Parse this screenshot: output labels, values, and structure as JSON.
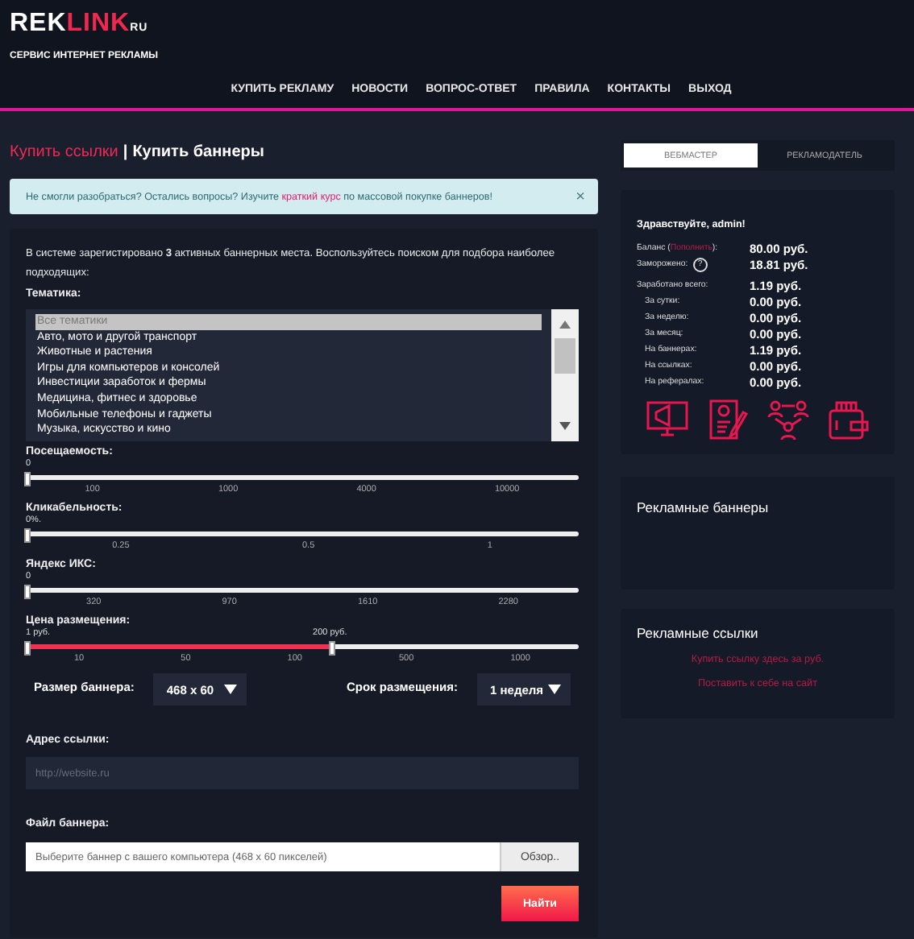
{
  "header": {
    "logo_main": "REK",
    "logo_accent": "LINK",
    "logo_suffix": "RU",
    "tagline": "СЕРВИС ИНТЕРНЕТ РЕКЛАМЫ",
    "nav": [
      {
        "label": "КУПИТЬ РЕКЛАМУ"
      },
      {
        "label": "НОВОСТИ"
      },
      {
        "label": "ВОПРОС-ОТВЕТ"
      },
      {
        "label": "ПРАВИЛА"
      },
      {
        "label": "КОНТАКТЫ"
      },
      {
        "label": "ВЫХОД"
      }
    ]
  },
  "page_title": {
    "link": "Купить ссылки",
    "separator": "|",
    "current": "Купить баннеры"
  },
  "alert": {
    "text_before": "Не смогли разобраться? Остались вопросы? Изучите ",
    "link": "краткий курс",
    "text_after": " по массовой покупке баннеров!",
    "close": "×"
  },
  "intro": "В системе зарегистировано **3** активных баннерных места. Воспользуйтесь поиском для подбора наиболее подходящих:",
  "topic": {
    "label": "Тематика:",
    "items": [
      {
        "label": "Все тематики",
        "selected": true
      },
      {
        "label": "Авто, мото и другой транспорт",
        "selected": false
      },
      {
        "label": "Животные и растения",
        "selected": false
      },
      {
        "label": "Игры для компьютеров и консолей",
        "selected": false
      },
      {
        "label": "Инвестиции заработок и фермы",
        "selected": false
      },
      {
        "label": "Медицина, фитнес и здоровье",
        "selected": false
      },
      {
        "label": "Мобильные телефоны и гаджеты",
        "selected": false
      },
      {
        "label": "Музыка, искусство и кино",
        "selected": false
      }
    ]
  },
  "sliders": [
    {
      "kind": "single",
      "label": "Посещаемость:",
      "value": "0",
      "level": 0,
      "ticks": [
        "100",
        "1000",
        "4000",
        "10000"
      ]
    },
    {
      "kind": "single",
      "label": "Кликабельность:",
      "value": "0%.",
      "level": 0,
      "ticks": [
        "0.25",
        "0.5",
        "1"
      ]
    },
    {
      "kind": "single",
      "label": "Яндекс ИКС:",
      "value": "0",
      "level": 0,
      "ticks": [
        "320",
        "970",
        "1610",
        "2280"
      ]
    },
    {
      "kind": "range",
      "label": "Цена размещения:",
      "value": "1 руб.",
      "value_end": "200 руб.",
      "level": 0.55,
      "ticks": [
        "10",
        "50",
        "100",
        "500",
        "1000"
      ]
    }
  ],
  "selects": [
    {
      "label": "Размер баннера:",
      "value": "468 x 60"
    },
    {
      "label": "Срок размещения:",
      "value": "1 неделя"
    }
  ],
  "link_address": {
    "label": "Адрес ссылки:",
    "placeholder": "http://website.ru"
  },
  "banner_file": {
    "label": "Файл баннера:",
    "placeholder": "Выберите баннер с вашего компьютера (468 x 60 пикселей)",
    "browse": "Обзор.."
  },
  "submit": "Найти",
  "role_tabs": [
    {
      "label": "ВЕБМАСТЕР",
      "selected": true
    },
    {
      "label": "РЕКЛАМОДАТЕЛЬ",
      "selected": false
    }
  ],
  "account": {
    "greeting": "Здравствуйте, admin!",
    "balance": {
      "before": "Баланс (",
      "link": "Пополнить",
      "after": "):",
      "value": "80.00 руб."
    },
    "frozen": {
      "label": "Заморожено:",
      "help": "?",
      "value": "18.81 руб."
    },
    "earnings": [
      {
        "label": "Заработано всего:",
        "value": "1.19 руб.",
        "indent": false
      },
      {
        "label": "За сутки:",
        "value": "0.00 руб.",
        "indent": true
      },
      {
        "label": "За неделю:",
        "value": "0.00 руб.",
        "indent": true
      },
      {
        "label": "За месяц:",
        "value": "0.00 руб.",
        "indent": true
      },
      {
        "label": "На баннерах:",
        "value": "1.19 руб.",
        "indent": true
      },
      {
        "label": "На ссылках:",
        "value": "0.00 руб.",
        "indent": true
      },
      {
        "label": "На рефералах:",
        "value": "0.00 руб.",
        "indent": true
      }
    ]
  },
  "banners_panel": {
    "title": "Рекламные баннеры"
  },
  "links_panel": {
    "title": "Рекламные ссылки",
    "links": [
      "Купить ссылку здесь за руб.",
      "Поставить к себе на сайт"
    ]
  }
}
